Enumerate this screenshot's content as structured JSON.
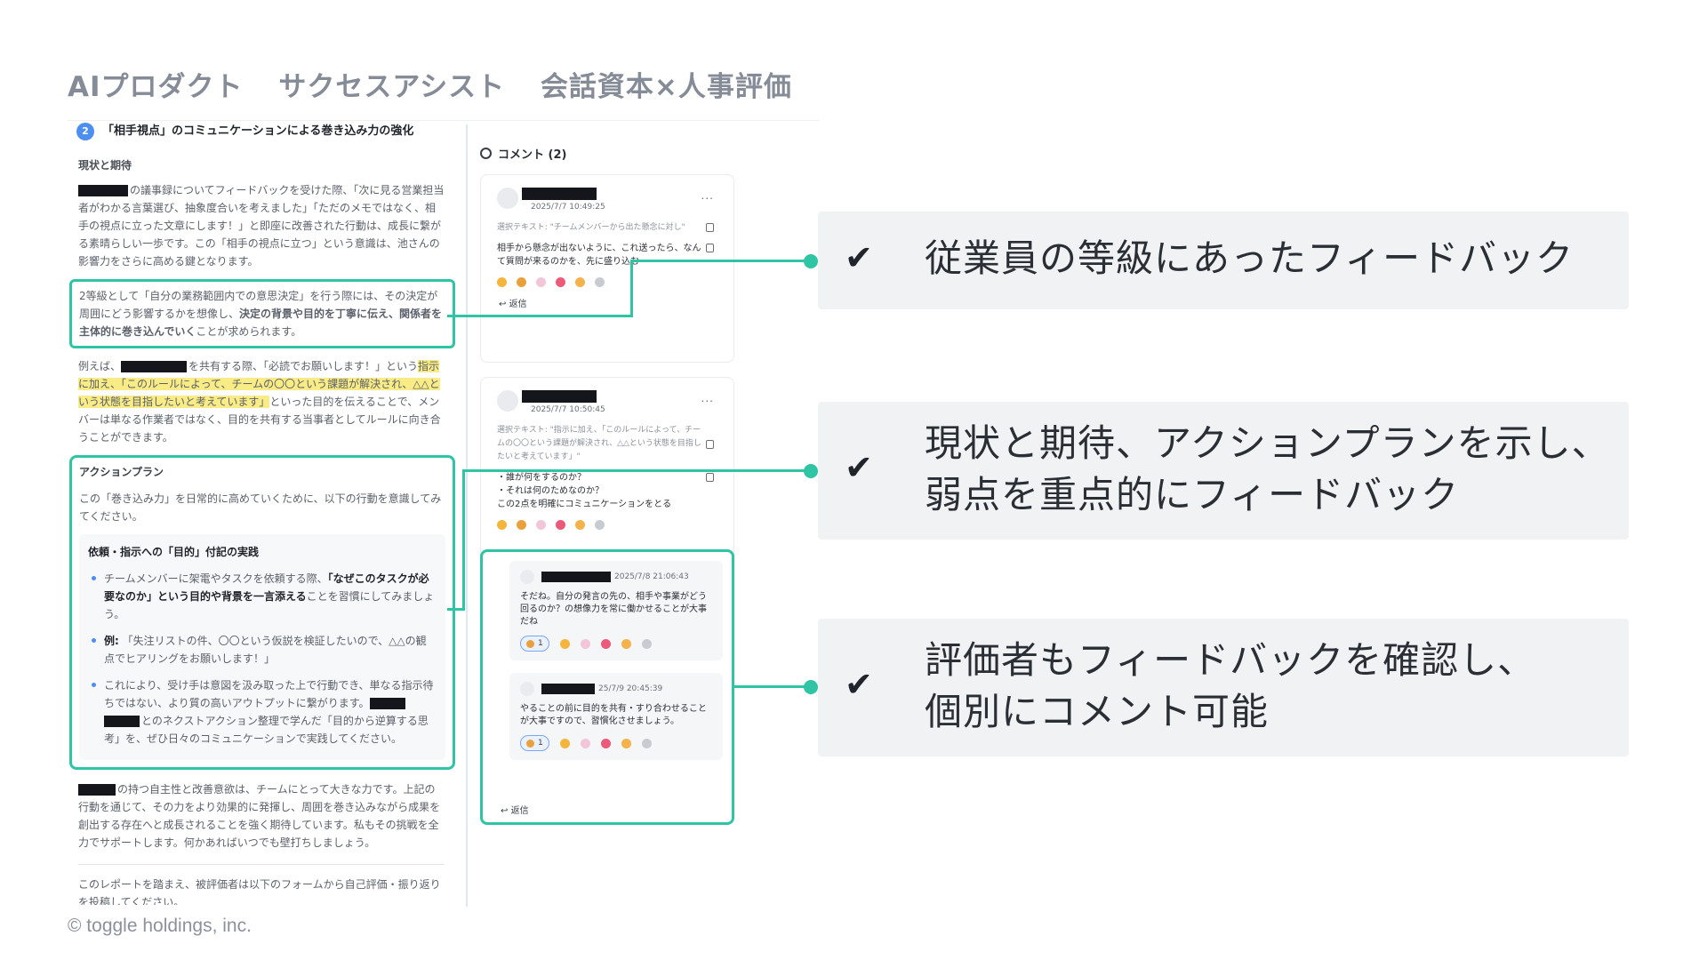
{
  "slide": {
    "title_parts": [
      "AIプロダクト",
      "サクセスアシスト",
      "会話資本×人事評価"
    ],
    "footer": "© toggle holdings, inc."
  },
  "doc": {
    "section_number": "2",
    "section_title": "「相手視点」のコミュニケーションによる巻き込み力の強化",
    "status_heading": "現状と期待",
    "para1_text": "の議事録についてフィードバックを受けた際、「次に見る営業担当者がわかる言葉選び、抽象度合いを考えました」「ただのメモではなく、相手の視点に立った文章にします！」と即座に改善された行動は、成長に繋がる素晴らしい一歩です。この「相手の視点に立つ」という意識は、池さんの影響力をさらに高める鍵となります。",
    "box1_pre": "2等級として「自分の業務範囲内での意思決定」を行う際には、その決定が周囲にどう影響するかを想像し、",
    "box1_bold": "決定の背景や目的を丁寧に伝え、関係者を主体的に巻き込んでいく",
    "box1_post": "ことが求められます。",
    "para2_pre": "例えば、",
    "para2_mid": "を共有する際、「必読でお願いします！」という",
    "para2_highlight": "指示に加え、「このルールによって、チームの〇〇という課題が解決され、△△という状態を目指したいと考えています」",
    "para2_post": "といった目的を伝えることで、メンバーは単なる作業者ではなく、目的を共有する当事者としてルールに向き合うことができます。",
    "action_heading": "アクションプラン",
    "action_intro": "この「巻き込み力」を日常的に高めていくために、以下の行動を意識してみてください。",
    "practice_title": "依頼・指示への「目的」付記の実践",
    "bullet1_pre": "チームメンバーに架電やタスクを依頼する際、",
    "bullet1_bold": "「なぜこのタスクが必要なのか」という目的や背景を一言添える",
    "bullet1_post": "ことを習慣にしてみましょう。",
    "bullet2_label": "例:",
    "bullet2_text": "「失注リストの件、〇〇という仮説を検証したいので、△△の観点でヒアリングをお願いします！」",
    "bullet3_pre": "これにより、受け手は意図を汲み取った上で行動でき、単なる指示待ちではない、より質の高いアウトプットに繋がります。",
    "bullet3_post": "とのネクストアクション整理で学んだ「目的から逆算する思考」を、ぜひ日々のコミュニケーションで実践してください。",
    "para3_text": "の持つ自主性と改善意欲は、チームにとって大きな力です。上記の行動を通じて、その力をより効果的に発揮し、周囲を巻き込みながら成果を創出する存在へと成長されることを強く期待しています。私もその挑戦を全力でサポートします。何かあればいつでも壁打ちしましょう。",
    "para4_text": "このレポートを踏まえ、被評価者は以下のフォームから自己評価・振り返りを投稿してください。"
  },
  "comments": {
    "header": "コメント (2)",
    "card1": {
      "timestamp": "2025/7/7 10:49:25",
      "selected_text": "選択テキスト: \"チームメンバーから出た懸念に対し\"",
      "body": "相手から懸念が出ないように、これ送ったら、なんて質問が来るのかを、先に盛り込む",
      "reply_label": "返信"
    },
    "card2": {
      "timestamp": "2025/7/7 10:50:45",
      "selected_text": "選択テキスト: \"指示に加え、「このルールによって、チームの〇〇という課題が解決され、△△という状態を目指したいと考えています」\"",
      "body_line1": "・誰が何をするのか？",
      "body_line2": "・それは何のためなのか？",
      "body_line3": "この2点を明確にコミュニケーションをとる"
    },
    "replies": [
      {
        "timestamp": "2025/7/8 21:06:43",
        "body": "そだね。自分の発言の先の、相手や事業がどう回るのか？の想像力を常に働かせることが大事だね",
        "reaction_count": "1"
      },
      {
        "timestamp": "25/7/9 20:45:39",
        "body": "やることの前に目的を共有・すり合わせることが大事ですので、習慣化させましょう。",
        "reaction_count": "1"
      }
    ],
    "thread_reply_label": "返信",
    "more_label": "..."
  },
  "features": [
    {
      "lines": [
        "従業員の等級にあったフィードバック"
      ]
    },
    {
      "lines": [
        "現状と期待、アクションプランを示し、",
        "弱点を重点的にフィードバック"
      ]
    },
    {
      "lines": [
        "評価者もフィードバックを確認し、",
        "個別にコメント可能"
      ]
    }
  ],
  "icons": {
    "check": "check-icon",
    "comment": "comment-bubble-icon",
    "reply": "reply-arrow-icon",
    "copy": "copy-icon"
  },
  "colors": {
    "accent": "#2fc4a3",
    "badge": "#4d8ff0",
    "highlight": "#f9ec86",
    "feature_bg": "#f1f2f4"
  }
}
